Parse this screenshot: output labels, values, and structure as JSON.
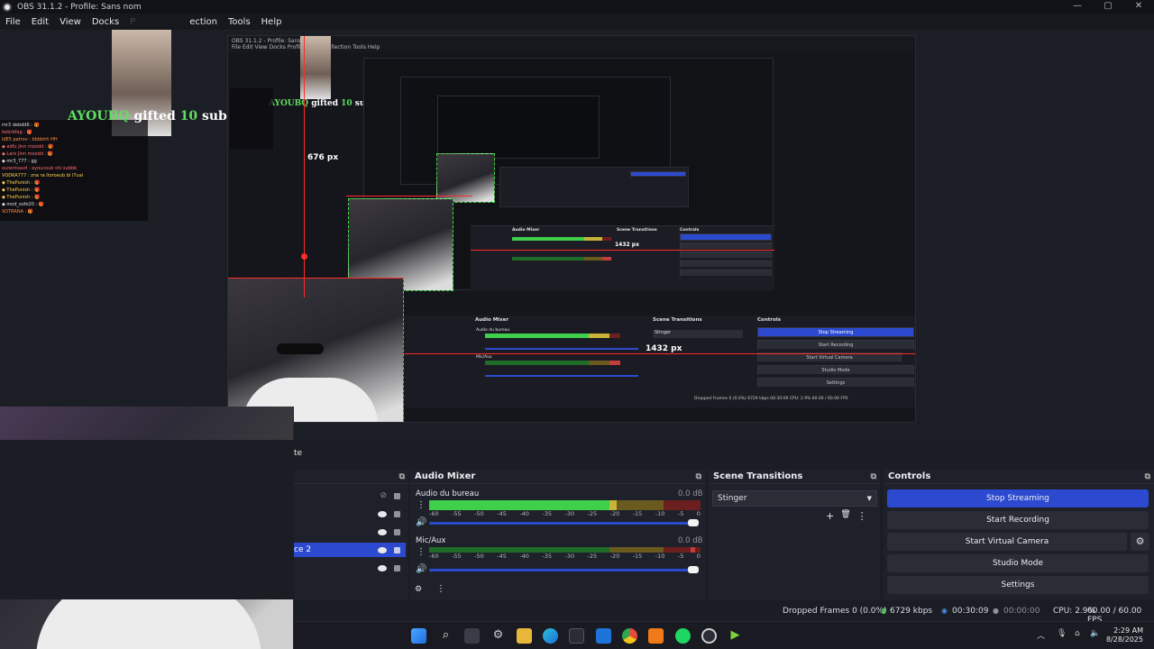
{
  "window": {
    "title": "OBS 31.1.2 - Profile: Sans nom",
    "controls": [
      "—",
      "▢",
      "✕"
    ]
  },
  "menu": [
    "File",
    "Edit",
    "View",
    "Docks",
    "P",
    "ection",
    "Tools",
    "Help"
  ],
  "preview": {
    "gift_user": "AYOUBQ",
    "gift_mid": " gifted ",
    "gift_count": "10",
    "gift_end": " sub(s)!",
    "width_label": "676 px",
    "height_label": "1432 px",
    "nested_height_label": "1432 px",
    "chat_lines": [
      "mr3 debdd6 : 🎁",
      "bebrbfag : 🎁",
      "ldE5 patrov : bbbbhh HH",
      "◆ adfu Jinn moodd : 🎁",
      "◆ Laro Jinn moodd : 🎁",
      "◆ mr3_777 : gg",
      "ourentsavd : ayoucoub shi subbb",
      "VODKA777 : zna ra ltoroeub bl l7ual",
      "◆ ThePunish : 🎁",
      "◆ ThePunish : 🎁",
      "◆ ThePunish : 🎁",
      "◆ mod_sofo20 : 🎁",
      "SOTRANA : 🎁"
    ]
  },
  "scenes": {
    "tab_fragment": "te",
    "selected_fragment": "ce 2",
    "rows": [
      {
        "selected": false
      },
      {
        "selected": false
      },
      {
        "selected": true
      },
      {
        "selected": false
      }
    ]
  },
  "audio_mixer": {
    "title": "Audio Mixer",
    "channels": [
      {
        "name": "Audio du bureau",
        "db": "0.0 dB",
        "level": 0.86
      },
      {
        "name": "Mic/Aux",
        "db": "0.0 dB",
        "level": 0.97
      }
    ],
    "ticks": [
      "-60",
      "-55",
      "-50",
      "-45",
      "-40",
      "-35",
      "-30",
      "-25",
      "-20",
      "-15",
      "-10",
      "-5",
      "0"
    ]
  },
  "scene_transitions": {
    "title": "Scene Transitions",
    "selected": "Stinger",
    "add": "+",
    "remove": "🗑",
    "more": "⋮"
  },
  "controls": {
    "title": "Controls",
    "stop_streaming": "Stop Streaming",
    "start_recording": "Start Recording",
    "start_virtual_camera": "Start Virtual Camera",
    "studio_mode": "Studio Mode",
    "settings": "Settings"
  },
  "status": {
    "dropped": "Dropped Frames 0 (0.0%)",
    "bitrate": "6729 kbps",
    "stream_time": "00:30:09",
    "rec_time": "00:00:00",
    "cpu": "CPU: 2.9%",
    "fps": "60.00 / 60.00 FPS"
  },
  "taskbar": {
    "time": "2:29 AM",
    "date": "8/28/2025"
  },
  "colors": {
    "accent": "#2c4ad0",
    "meter_green": "#3ed04a",
    "meter_yellow": "#c9b43a",
    "meter_red": "#c43c3c",
    "guide_red": "#ff2a2a"
  }
}
